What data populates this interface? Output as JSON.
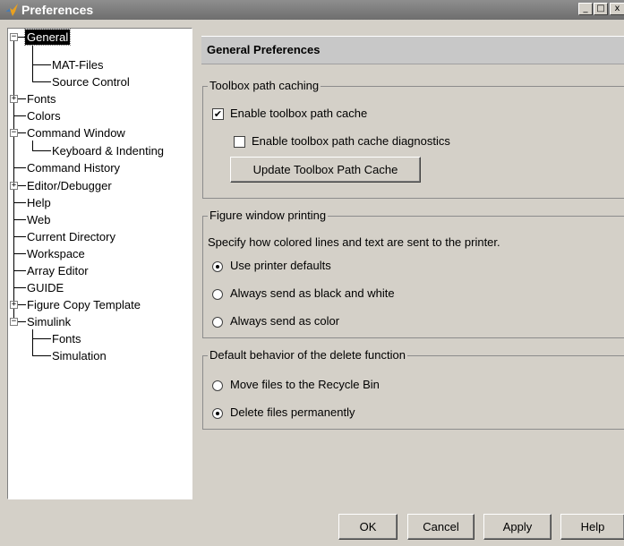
{
  "window": {
    "title": "Preferences",
    "minimize_glyph": "_",
    "maximize_glyph": "□",
    "close_glyph": "x"
  },
  "tree": [
    {
      "label": "General",
      "expander": "−"
    },
    {
      "label": "MAT-Files"
    },
    {
      "label": "Source Control"
    },
    {
      "label": "Fonts",
      "expander": "+"
    },
    {
      "label": "Colors"
    },
    {
      "label": "Command Window",
      "expander": "−"
    },
    {
      "label": "Keyboard & Indenting"
    },
    {
      "label": "Command History"
    },
    {
      "label": "Editor/Debugger",
      "expander": "+"
    },
    {
      "label": "Help"
    },
    {
      "label": "Web"
    },
    {
      "label": "Current Directory"
    },
    {
      "label": "Workspace"
    },
    {
      "label": "Array Editor"
    },
    {
      "label": "GUIDE"
    },
    {
      "label": "Figure Copy Template",
      "expander": "+"
    },
    {
      "label": "Simulink",
      "expander": "−"
    },
    {
      "label": "Fonts"
    },
    {
      "label": "Simulation"
    }
  ],
  "selected_tree_item": "General",
  "panel": {
    "title": "General Preferences"
  },
  "toolbox_group": {
    "legend": "Toolbox path caching",
    "enable_cache_label": "Enable toolbox path cache",
    "enable_cache_checked": true,
    "diagnostics_label": "Enable toolbox path cache diagnostics",
    "diagnostics_checked": false,
    "update_button_label": "Update Toolbox Path Cache",
    "check_glyph": "✔"
  },
  "printing_group": {
    "legend": "Figure window printing",
    "description": "Specify how colored lines and text are sent to the printer.",
    "options": [
      {
        "label": "Use printer defaults",
        "selected": true
      },
      {
        "label": "Always send as black and white",
        "selected": false
      },
      {
        "label": "Always send as color",
        "selected": false
      }
    ]
  },
  "delete_group": {
    "legend": "Default behavior of the delete function",
    "options": [
      {
        "label": "Move files to the Recycle Bin",
        "selected": false
      },
      {
        "label": "Delete files permanently",
        "selected": true
      }
    ]
  },
  "buttons": {
    "ok": "OK",
    "cancel": "Cancel",
    "apply": "Apply",
    "help": "Help"
  },
  "icons": {
    "app": "matlab-icon"
  }
}
